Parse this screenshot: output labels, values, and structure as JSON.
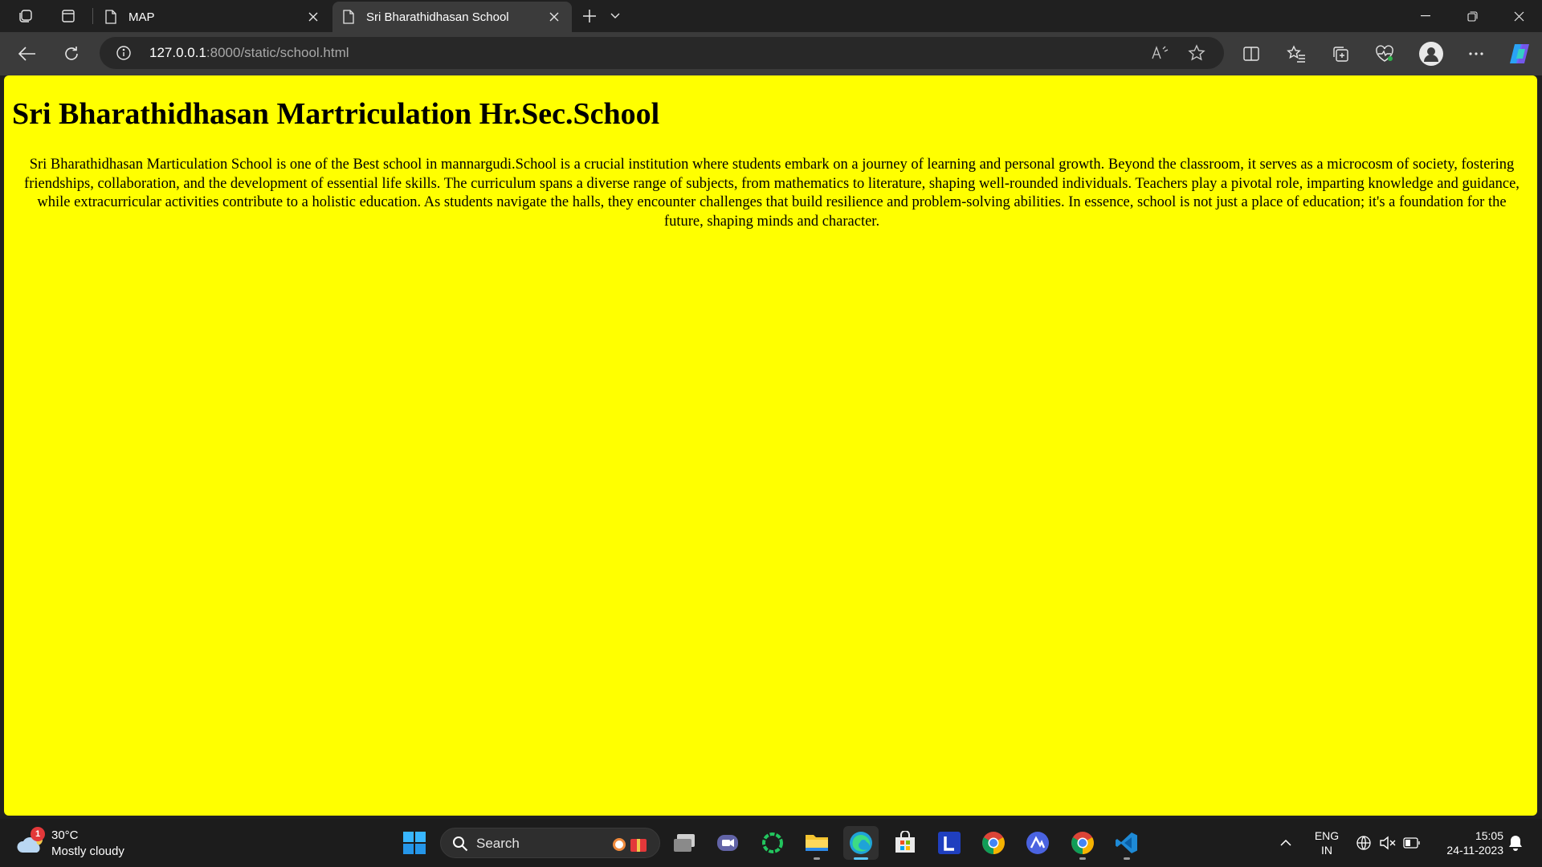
{
  "browser": {
    "tabs": [
      {
        "title": "MAP",
        "active": false
      },
      {
        "title": "Sri Bharathidhasan School",
        "active": true
      }
    ],
    "address": {
      "host": "127.0.0.1",
      "path": ":8000/static/school.html"
    }
  },
  "page": {
    "heading": "Sri Bharathidhasan Martriculation Hr.Sec.School",
    "body": "Sri Bharathidhasan Marticulation School is one of the Best school in mannargudi.School is a crucial institution where students embark on a journey of learning and personal growth. Beyond the classroom, it serves as a microcosm of society, fostering friendships, collaboration, and the development of essential life skills. The curriculum spans a diverse range of subjects, from mathematics to literature, shaping well-rounded individuals. Teachers play a pivotal role, imparting knowledge and guidance, while extracurricular activities contribute to a holistic education. As students navigate the halls, they encounter challenges that build resilience and problem-solving abilities. In essence, school is not just a place of education; it's a foundation for the future, shaping minds and character.",
    "background_color": "#ffff00"
  },
  "taskbar": {
    "weather": {
      "badge": "1",
      "temperature": "30°C",
      "condition": "Mostly cloudy"
    },
    "search_label": "Search",
    "language": {
      "line1": "ENG",
      "line2": "IN"
    },
    "clock": {
      "time": "15:05",
      "date": "24-11-2023"
    },
    "apps": [
      "file-explorer-window",
      "meet",
      "app-ring",
      "file-explorer",
      "edge",
      "microsoft-store",
      "l-app",
      "chrome",
      "arc-app",
      "chrome-2",
      "vscode"
    ]
  }
}
